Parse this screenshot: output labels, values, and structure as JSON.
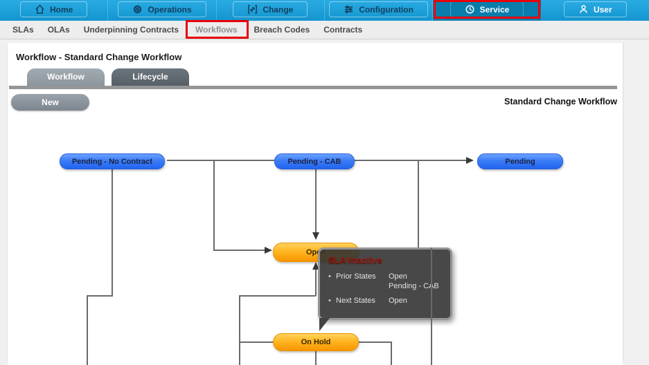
{
  "nav": {
    "items": [
      {
        "label": "Home",
        "icon": "home-icon"
      },
      {
        "label": "Operations",
        "icon": "operations-icon"
      },
      {
        "label": "Change",
        "icon": "change-icon"
      },
      {
        "label": "Configuration",
        "icon": "configuration-icon"
      },
      {
        "label": "Service",
        "icon": "service-icon",
        "selected": true,
        "annotated": true
      },
      {
        "label": "User",
        "icon": "user-icon"
      }
    ]
  },
  "subnav": {
    "items": [
      {
        "label": "SLAs"
      },
      {
        "label": "OLAs"
      },
      {
        "label": "Underpinning Contracts"
      },
      {
        "label": "Workflows",
        "highlighted": true,
        "annotated": true
      },
      {
        "label": "Breach Codes"
      },
      {
        "label": "Contracts"
      }
    ]
  },
  "page": {
    "title": "Workflow - Standard Change Workflow"
  },
  "tabs": [
    {
      "label": "Workflow",
      "active": true
    },
    {
      "label": "Lifecycle",
      "active": false
    }
  ],
  "toolbar": {
    "new_label": "New",
    "workflow_name": "Standard Change Workflow"
  },
  "diagram": {
    "nodes": [
      {
        "label": "Pending - No Contract",
        "color": "blue"
      },
      {
        "label": "Pending - CAB",
        "color": "blue"
      },
      {
        "label": "Pending",
        "color": "blue"
      },
      {
        "label": "Open",
        "color": "orange"
      },
      {
        "label": "On Hold",
        "color": "orange"
      }
    ],
    "connections": [
      {
        "from": "Pending - No Contract",
        "to": "Pending - CAB"
      },
      {
        "from": "Pending - No Contract",
        "to": "Open",
        "arrow": true
      },
      {
        "from": "Pending - CAB",
        "to": "Open",
        "arrow": true
      },
      {
        "from": "Pending - CAB",
        "to": "Pending",
        "arrow": true
      },
      {
        "from": "below",
        "to": "Open",
        "arrow": true
      },
      {
        "from": "On Hold",
        "to": "edges"
      }
    ],
    "tooltip": {
      "title": "SLA Inactive",
      "rows": [
        {
          "label": "Prior States",
          "values": [
            "Open",
            "Pending - CAB"
          ]
        },
        {
          "label": "Next States",
          "values": [
            "Open"
          ]
        }
      ]
    }
  },
  "colors": {
    "nav_bar": "#1a9fd4",
    "nav_selected": "#0a7cab",
    "annotation_red": "#e8000a",
    "node_blue": "#2f6ef2",
    "node_orange": "#ffa81c",
    "tooltip_bg": "#343434",
    "tooltip_title_red": "#9e1208"
  }
}
